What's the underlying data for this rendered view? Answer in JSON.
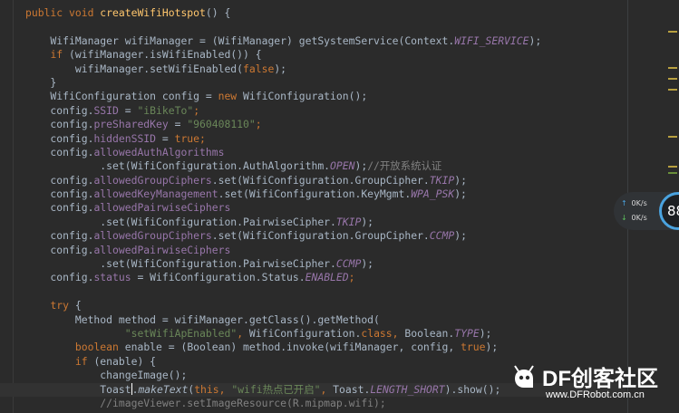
{
  "editor": {
    "lines": [
      [
        {
          "t": "public void ",
          "c": "#cc7832"
        },
        {
          "t": "createWifiHotspot",
          "c": "#ffc66d"
        },
        {
          "t": "() {",
          "c": "#a9b7c6"
        }
      ],
      [],
      [
        {
          "t": "    WifiManager wifiManager = (WifiManager) getSystemService(Context.",
          "c": "#a9b7c6"
        },
        {
          "t": "WIFI_SERVICE",
          "c": "#9876aa",
          "i": 1
        },
        {
          "t": ");",
          "c": "#a9b7c6"
        }
      ],
      [
        {
          "t": "    ",
          "c": "#a9b7c6"
        },
        {
          "t": "if ",
          "c": "#cc7832"
        },
        {
          "t": "(wifiManager.isWifiEnabled()) {",
          "c": "#a9b7c6"
        }
      ],
      [
        {
          "t": "        wifiManager.setWifiEnabled(",
          "c": "#a9b7c6"
        },
        {
          "t": "false",
          "c": "#cc7832"
        },
        {
          "t": ");",
          "c": "#a9b7c6"
        }
      ],
      [
        {
          "t": "    }",
          "c": "#a9b7c6"
        }
      ],
      [
        {
          "t": "    WifiConfiguration config = ",
          "c": "#a9b7c6"
        },
        {
          "t": "new ",
          "c": "#cc7832"
        },
        {
          "t": "WifiConfiguration();",
          "c": "#a9b7c6"
        }
      ],
      [
        {
          "t": "    config.",
          "c": "#a9b7c6"
        },
        {
          "t": "SSID",
          "c": "#9876aa"
        },
        {
          "t": " = ",
          "c": "#a9b7c6"
        },
        {
          "t": "\"iBikeTo\"",
          "c": "#6a8759"
        },
        {
          "t": ";",
          "c": "#cc7832"
        }
      ],
      [
        {
          "t": "    config.",
          "c": "#a9b7c6"
        },
        {
          "t": "preSharedKey",
          "c": "#9876aa"
        },
        {
          "t": " = ",
          "c": "#a9b7c6"
        },
        {
          "t": "\"960408110\"",
          "c": "#6a8759"
        },
        {
          "t": ";",
          "c": "#cc7832"
        }
      ],
      [
        {
          "t": "    config.",
          "c": "#a9b7c6"
        },
        {
          "t": "hiddenSSID",
          "c": "#9876aa"
        },
        {
          "t": " = ",
          "c": "#a9b7c6"
        },
        {
          "t": "true",
          "c": "#cc7832"
        },
        {
          "t": ";",
          "c": "#cc7832"
        }
      ],
      [
        {
          "t": "    config.",
          "c": "#a9b7c6"
        },
        {
          "t": "allowedAuthAlgorithms",
          "c": "#9876aa"
        }
      ],
      [
        {
          "t": "            .set(WifiConfiguration.AuthAlgorithm.",
          "c": "#a9b7c6"
        },
        {
          "t": "OPEN",
          "c": "#9876aa",
          "i": 1
        },
        {
          "t": ");",
          "c": "#a9b7c6"
        },
        {
          "t": "//开放系统认证",
          "c": "#808080"
        }
      ],
      [
        {
          "t": "    config.",
          "c": "#a9b7c6"
        },
        {
          "t": "allowedGroupCiphers",
          "c": "#9876aa"
        },
        {
          "t": ".set(WifiConfiguration.GroupCipher.",
          "c": "#a9b7c6"
        },
        {
          "t": "TKIP",
          "c": "#9876aa",
          "i": 1
        },
        {
          "t": ");",
          "c": "#a9b7c6"
        }
      ],
      [
        {
          "t": "    config.",
          "c": "#a9b7c6"
        },
        {
          "t": "allowedKeyManagement",
          "c": "#9876aa"
        },
        {
          "t": ".set(WifiConfiguration.KeyMgmt.",
          "c": "#a9b7c6"
        },
        {
          "t": "WPA_PSK",
          "c": "#9876aa",
          "i": 1
        },
        {
          "t": ");",
          "c": "#a9b7c6"
        }
      ],
      [
        {
          "t": "    config.",
          "c": "#a9b7c6"
        },
        {
          "t": "allowedPairwiseCiphers",
          "c": "#9876aa"
        }
      ],
      [
        {
          "t": "            .set(WifiConfiguration.PairwiseCipher.",
          "c": "#a9b7c6"
        },
        {
          "t": "TKIP",
          "c": "#9876aa",
          "i": 1
        },
        {
          "t": ");",
          "c": "#a9b7c6"
        }
      ],
      [
        {
          "t": "    config.",
          "c": "#a9b7c6"
        },
        {
          "t": "allowedGroupCiphers",
          "c": "#9876aa"
        },
        {
          "t": ".set(WifiConfiguration.GroupCipher.",
          "c": "#a9b7c6"
        },
        {
          "t": "CCMP",
          "c": "#9876aa",
          "i": 1
        },
        {
          "t": ");",
          "c": "#a9b7c6"
        }
      ],
      [
        {
          "t": "    config.",
          "c": "#a9b7c6"
        },
        {
          "t": "allowedPairwiseCiphers",
          "c": "#9876aa"
        }
      ],
      [
        {
          "t": "            .set(WifiConfiguration.PairwiseCipher.",
          "c": "#a9b7c6"
        },
        {
          "t": "CCMP",
          "c": "#9876aa",
          "i": 1
        },
        {
          "t": ");",
          "c": "#a9b7c6"
        }
      ],
      [
        {
          "t": "    config.",
          "c": "#a9b7c6"
        },
        {
          "t": "status",
          "c": "#9876aa"
        },
        {
          "t": " = WifiConfiguration.Status.",
          "c": "#a9b7c6"
        },
        {
          "t": "ENABLED",
          "c": "#9876aa",
          "i": 1
        },
        {
          "t": ";",
          "c": "#cc7832"
        }
      ],
      [],
      [
        {
          "t": "    ",
          "c": "#a9b7c6"
        },
        {
          "t": "try ",
          "c": "#cc7832"
        },
        {
          "t": "{",
          "c": "#a9b7c6"
        }
      ],
      [
        {
          "t": "        Method method = wifiManager.getClass().getMethod(",
          "c": "#a9b7c6"
        }
      ],
      [
        {
          "t": "                ",
          "c": "#a9b7c6"
        },
        {
          "t": "\"setWifiApEnabled\"",
          "c": "#6a8759"
        },
        {
          "t": ", ",
          "c": "#cc7832"
        },
        {
          "t": "WifiConfiguration.",
          "c": "#a9b7c6"
        },
        {
          "t": "class",
          "c": "#cc7832"
        },
        {
          "t": ", ",
          "c": "#cc7832"
        },
        {
          "t": "Boolean.",
          "c": "#a9b7c6"
        },
        {
          "t": "TYPE",
          "c": "#9876aa",
          "i": 1
        },
        {
          "t": ");",
          "c": "#a9b7c6"
        }
      ],
      [
        {
          "t": "        ",
          "c": "#a9b7c6"
        },
        {
          "t": "boolean ",
          "c": "#cc7832"
        },
        {
          "t": "enable = (Boolean) method.invoke(wifiManager, config, ",
          "c": "#a9b7c6"
        },
        {
          "t": "true",
          "c": "#cc7832"
        },
        {
          "t": ");",
          "c": "#a9b7c6"
        }
      ],
      [
        {
          "t": "        ",
          "c": "#a9b7c6"
        },
        {
          "t": "if ",
          "c": "#cc7832"
        },
        {
          "t": "(enable) {",
          "c": "#a9b7c6"
        }
      ],
      [
        {
          "t": "            changeImage();",
          "c": "#a9b7c6"
        }
      ],
      [
        {
          "t": "            Toast",
          "c": "#a9b7c6"
        },
        {
          "caret": 1
        },
        {
          "t": ".",
          "c": "#a9b7c6"
        },
        {
          "t": "makeText",
          "c": "#a9b7c6",
          "i": 1
        },
        {
          "t": "(",
          "c": "#a9b7c6"
        },
        {
          "t": "this",
          "c": "#cc7832"
        },
        {
          "t": ", ",
          "c": "#cc7832"
        },
        {
          "t": "\"wifi热点已开启\"",
          "c": "#6a8759"
        },
        {
          "t": ", ",
          "c": "#cc7832"
        },
        {
          "t": "Toast.",
          "c": "#a9b7c6"
        },
        {
          "t": "LENGTH_SHORT",
          "c": "#9876aa",
          "i": 1
        },
        {
          "t": ").show();",
          "c": "#a9b7c6"
        }
      ],
      [
        {
          "t": "            //imageViewer.setImageResource(R.mipmap.wifi);",
          "c": "#808080"
        }
      ]
    ]
  },
  "net_widget": {
    "upload": "0K/s",
    "download": "0K/s",
    "gauge_value": "88"
  },
  "watermark": {
    "title": "DF创客社区",
    "url": "www.DFRobot.com.cn"
  },
  "colors": {
    "background": "#2b2b2b",
    "keyword": "#cc7832",
    "method_decl": "#ffc66d",
    "field": "#9876aa",
    "string": "#6a8759",
    "comment": "#808080",
    "default": "#a9b7c6"
  }
}
